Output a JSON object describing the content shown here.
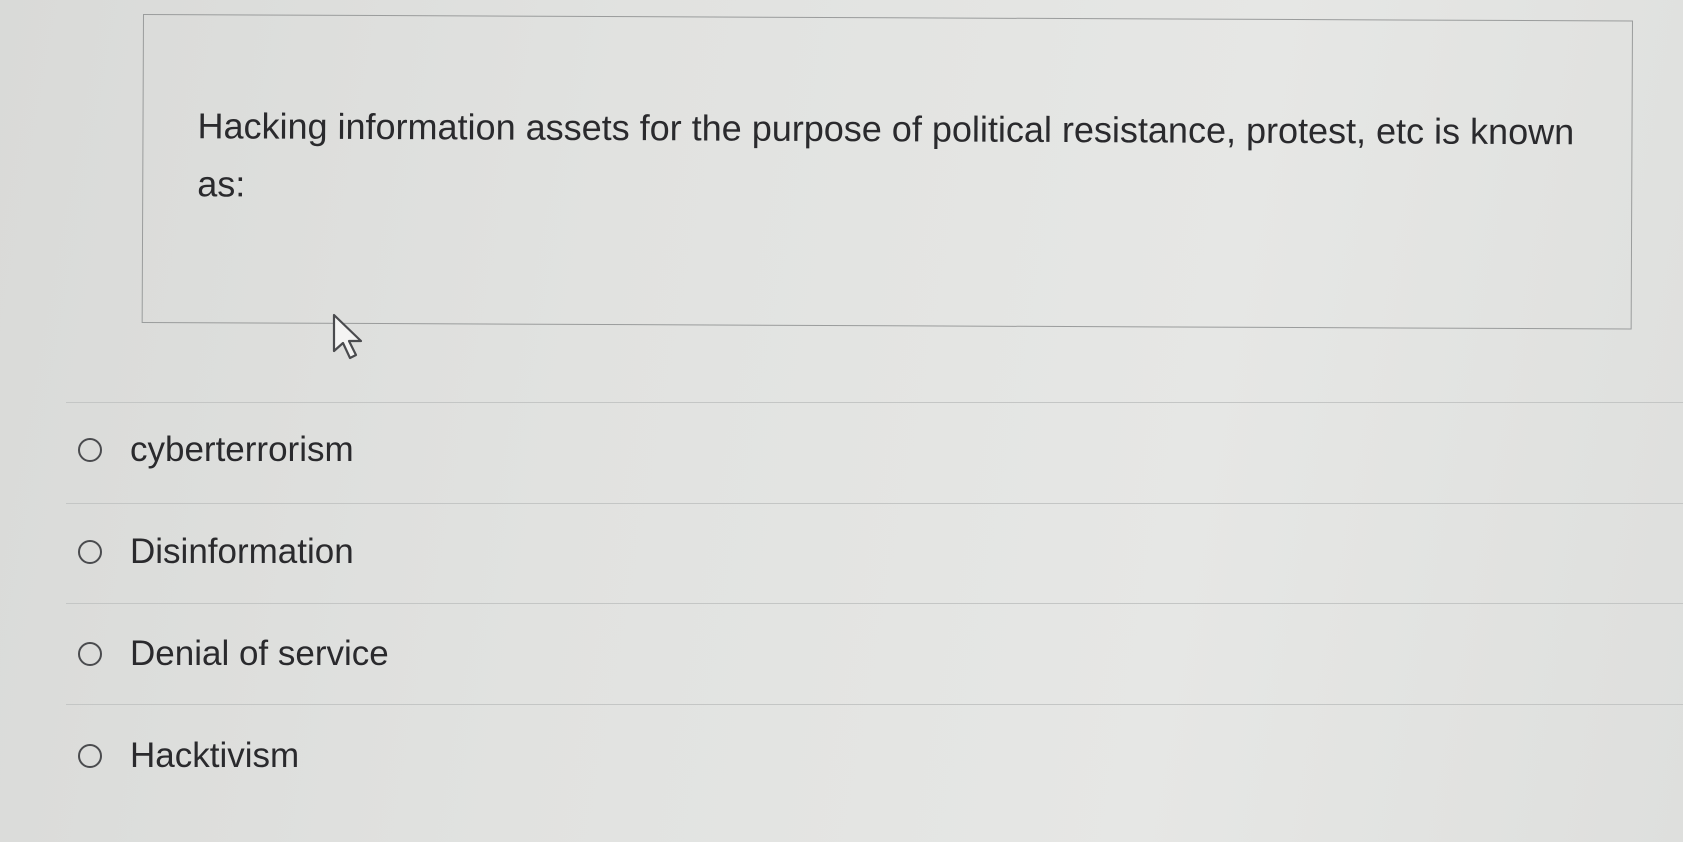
{
  "question": {
    "text": "Hacking information assets for the purpose of political resistance, protest, etc is known as:"
  },
  "cursor": {
    "icon": "mouse-pointer-icon"
  },
  "options": [
    {
      "label": "cyberterrorism",
      "selected": false
    },
    {
      "label": "Disinformation",
      "selected": false
    },
    {
      "label": "Denial of service",
      "selected": false
    },
    {
      "label": "Hacktivism",
      "selected": false
    }
  ]
}
